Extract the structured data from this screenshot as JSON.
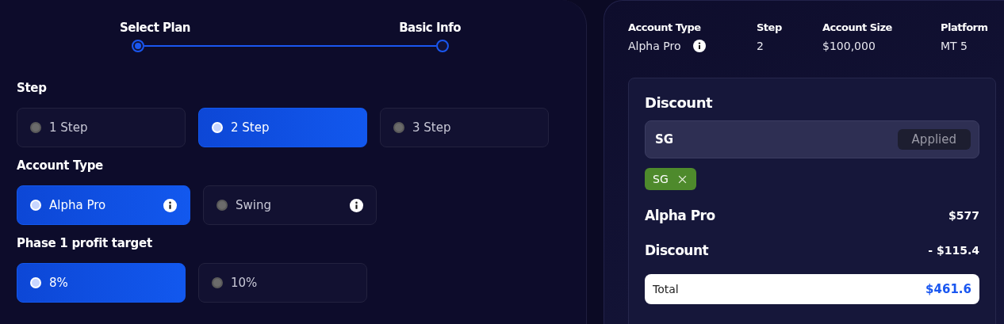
{
  "stepper": [
    {
      "label": "Select Plan",
      "selected": true
    },
    {
      "label": "Basic Info",
      "selected": false
    }
  ],
  "sections": [
    {
      "title": "Step",
      "options": [
        {
          "label": "1 Step",
          "selected": false,
          "info": false
        },
        {
          "label": "2 Step",
          "selected": true,
          "info": false
        },
        {
          "label": "3 Step",
          "selected": false,
          "info": false
        }
      ]
    },
    {
      "title": "Account Type",
      "options": [
        {
          "label": "Alpha Pro",
          "selected": true,
          "info": true
        },
        {
          "label": "Swing",
          "selected": false,
          "info": true
        }
      ]
    },
    {
      "title": "Phase 1 profit target",
      "options": [
        {
          "label": "8%",
          "selected": true,
          "info": false
        },
        {
          "label": "10%",
          "selected": false,
          "info": false
        }
      ]
    }
  ],
  "summary": [
    {
      "header": "Account Type",
      "value": "Alpha Pro",
      "info": true
    },
    {
      "header": "Step",
      "value": "2",
      "info": false
    },
    {
      "header": "Account Size",
      "value": "$100,000",
      "info": false
    },
    {
      "header": "Platform",
      "value": "MT 5",
      "info": false
    }
  ],
  "discount": {
    "title": "Discount",
    "code": "SG",
    "button": "Applied",
    "tags": [
      {
        "label": "SG"
      }
    ],
    "lines": [
      {
        "label": "Alpha Pro",
        "amount": "$577"
      },
      {
        "label": "Discount",
        "amount": "- $115.4"
      }
    ],
    "total": {
      "label": "Total",
      "amount": "$461.6"
    }
  }
}
